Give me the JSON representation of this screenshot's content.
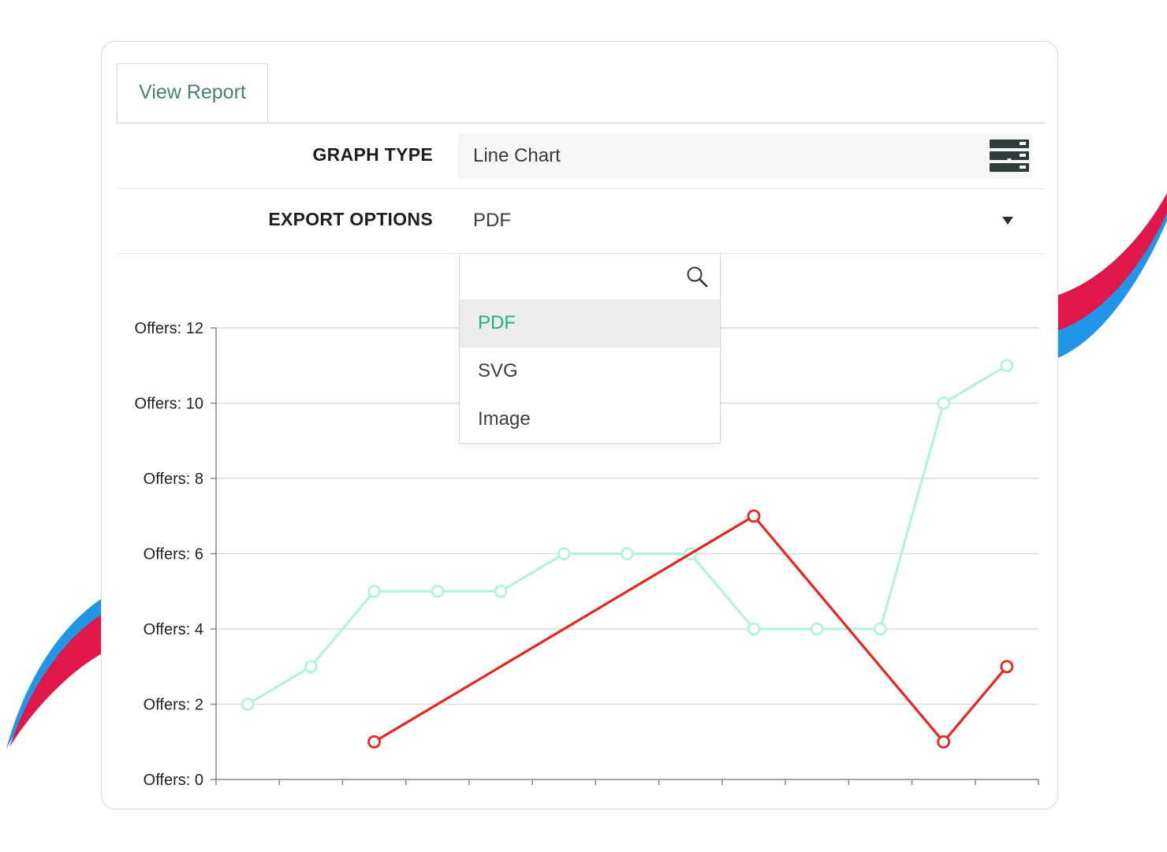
{
  "tab": {
    "label": "View Report"
  },
  "graph_type": {
    "label": "GRAPH TYPE",
    "value": "Line Chart",
    "icon": "graph-type-icon"
  },
  "export_options": {
    "label": "EXPORT OPTIONS",
    "value": "PDF",
    "search_placeholder": "",
    "options": [
      "PDF",
      "SVG",
      "Image"
    ],
    "selected": "PDF"
  },
  "colors": {
    "accent": "#1db37b",
    "series_teal": "#b3f2e1",
    "series_red": "#e8261f"
  },
  "chart_data": {
    "type": "line",
    "y_tick_labels": [
      "Offers: 0",
      "Offers: 2",
      "Offers: 4",
      "Offers: 6",
      "Offers: 8",
      "Offers: 10",
      "Offers: 12"
    ],
    "ylim": [
      0,
      12
    ],
    "x": [
      1,
      2,
      3,
      4,
      5,
      6,
      7,
      8,
      9,
      10,
      11,
      12,
      13,
      14
    ],
    "series": [
      {
        "color": "#b3f2e1",
        "points": [
          [
            1,
            2
          ],
          [
            2,
            3
          ],
          [
            3,
            5
          ],
          [
            4,
            5
          ],
          [
            5,
            5
          ],
          [
            6,
            6
          ],
          [
            7,
            6
          ],
          [
            8,
            6
          ],
          [
            9,
            4
          ],
          [
            10,
            4
          ],
          [
            11,
            4
          ],
          [
            12,
            10
          ],
          [
            13,
            11
          ]
        ]
      },
      {
        "color": "#e8261f",
        "points": [
          [
            3,
            1
          ],
          [
            9,
            7
          ],
          [
            12,
            1
          ],
          [
            13,
            3
          ]
        ]
      }
    ],
    "grid": true,
    "legend": "none"
  }
}
